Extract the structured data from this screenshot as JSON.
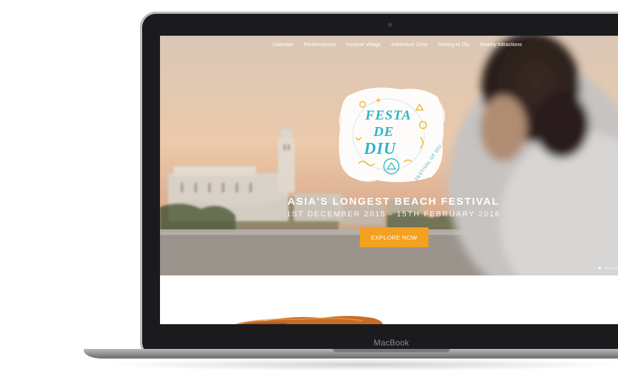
{
  "device": {
    "brand_label": "MacBook"
  },
  "nav": {
    "items": [
      "Calendar",
      "Performances",
      "Festival Village",
      "Adventure Zone",
      "Getting to Diu",
      "Nearby Attractions"
    ]
  },
  "logo": {
    "line1": "FESTA",
    "line2": "DE",
    "line3": "DIU",
    "tagline": "FESTIVAL OF DIU"
  },
  "hero": {
    "headline": "ASIA'S LONGEST BEACH FESTIVAL",
    "dates": "1ST DECEMBER 2015 - 15TH FEBRUARY 2016",
    "cta_label": "EXPLORE NOW",
    "mute_label": "Mute / Un"
  },
  "colors": {
    "accent": "#f4a020",
    "logo_teal": "#2fb4c8",
    "logo_yellow": "#f6b021",
    "sky": "#e8cbb0"
  },
  "icons": {
    "speaker": "speaker-icon",
    "camera": "camera-dot"
  }
}
